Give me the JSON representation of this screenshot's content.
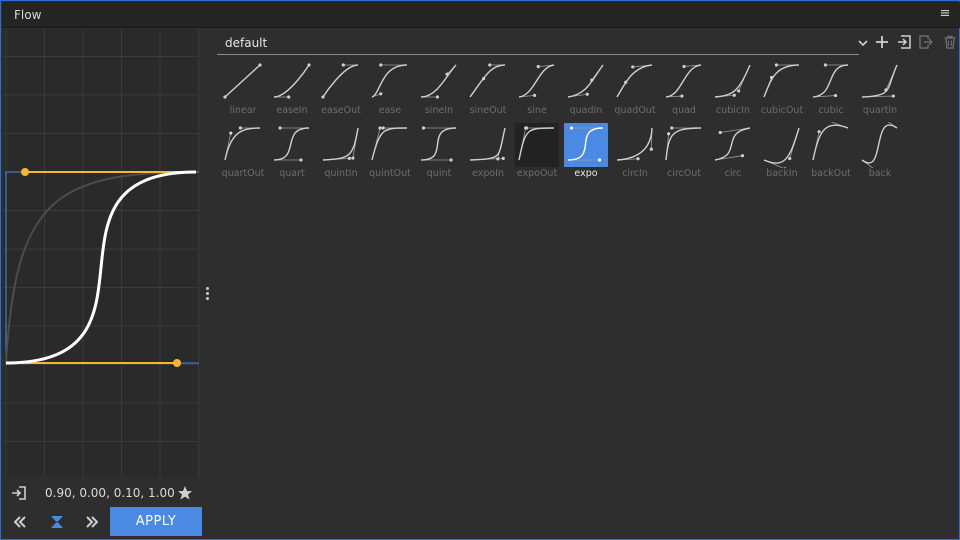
{
  "app": {
    "title": "Flow"
  },
  "editor": {
    "values_text": "0.90, 0.00, 0.10, 1.00",
    "bezier": [
      0.9,
      0.0,
      0.1,
      1.0
    ],
    "apply_label": "APPLY",
    "curve_color": "#ffffff",
    "handle_color": "#f5b731",
    "accent_color": "#4a8ae4"
  },
  "library": {
    "preset": "default",
    "tools": [
      "add-icon",
      "save-icon",
      "export-icon",
      "delete-icon"
    ],
    "presets": [
      {
        "label": "linear",
        "b": [
          0.0,
          0.0,
          1.0,
          1.0
        ]
      },
      {
        "label": "easeIn",
        "b": [
          0.42,
          0.0,
          1.0,
          1.0
        ]
      },
      {
        "label": "easeOut",
        "b": [
          0.0,
          0.0,
          0.58,
          1.0
        ]
      },
      {
        "label": "ease",
        "b": [
          0.25,
          0.1,
          0.25,
          1.0
        ]
      },
      {
        "label": "sineIn",
        "b": [
          0.47,
          0.0,
          0.745,
          0.715
        ]
      },
      {
        "label": "sineOut",
        "b": [
          0.39,
          0.575,
          0.565,
          1.0
        ]
      },
      {
        "label": "sine",
        "b": [
          0.445,
          0.05,
          0.55,
          0.95
        ]
      },
      {
        "label": "quadIn",
        "b": [
          0.55,
          0.085,
          0.68,
          0.53
        ]
      },
      {
        "label": "quadOut",
        "b": [
          0.25,
          0.46,
          0.45,
          0.94
        ]
      },
      {
        "label": "quad",
        "b": [
          0.455,
          0.03,
          0.515,
          0.955
        ]
      },
      {
        "label": "cubicIn",
        "b": [
          0.55,
          0.055,
          0.675,
          0.19
        ]
      },
      {
        "label": "cubicOut",
        "b": [
          0.215,
          0.61,
          0.355,
          1.0
        ]
      },
      {
        "label": "cubic",
        "b": [
          0.645,
          0.045,
          0.355,
          1.0
        ]
      },
      {
        "label": "quartIn",
        "b": [
          0.895,
          0.03,
          0.685,
          0.22
        ]
      },
      {
        "label": "quartOut",
        "b": [
          0.165,
          0.84,
          0.44,
          1.0
        ]
      },
      {
        "label": "quart",
        "b": [
          0.77,
          0.0,
          0.175,
          1.0
        ]
      },
      {
        "label": "quintIn",
        "b": [
          0.755,
          0.05,
          0.855,
          0.06
        ]
      },
      {
        "label": "quintOut",
        "b": [
          0.23,
          1.0,
          0.32,
          1.0
        ]
      },
      {
        "label": "quint",
        "b": [
          0.86,
          0.0,
          0.07,
          1.0
        ]
      },
      {
        "label": "expoIn",
        "b": [
          0.95,
          0.05,
          0.795,
          0.035
        ]
      },
      {
        "label": "expoOut",
        "b": [
          0.19,
          1.0,
          0.22,
          1.0
        ]
      },
      {
        "label": "expo",
        "b": [
          0.9,
          0.0,
          0.1,
          1.0
        ]
      },
      {
        "label": "circIn",
        "b": [
          0.6,
          0.04,
          0.98,
          0.335
        ]
      },
      {
        "label": "circOut",
        "b": [
          0.075,
          0.82,
          0.165,
          1.0
        ]
      },
      {
        "label": "circ",
        "b": [
          0.785,
          0.135,
          0.15,
          0.86
        ]
      },
      {
        "label": "backIn",
        "b": [
          0.6,
          -0.28,
          0.735,
          0.045
        ]
      },
      {
        "label": "backOut",
        "b": [
          0.175,
          0.885,
          0.32,
          1.275
        ]
      },
      {
        "label": "back",
        "b": [
          0.68,
          -0.55,
          0.265,
          1.55
        ]
      }
    ],
    "selected": "expo",
    "hovered": "expoOut"
  }
}
